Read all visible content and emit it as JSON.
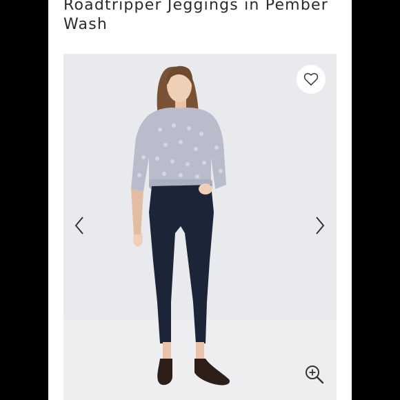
{
  "product": {
    "title": "Roadtripper Jeggings in Pember Wash"
  },
  "gallery": {
    "background_color": "#e9eaee",
    "icons": {
      "favorite": "heart-icon",
      "previous": "chevron-left-icon",
      "next": "chevron-right-icon",
      "zoom": "zoom-in-icon"
    }
  },
  "colors": {
    "sweater": "#b9bccb",
    "jeans": "#1c2438",
    "hair": "#7a5235",
    "shoes": "#2e1e18"
  }
}
